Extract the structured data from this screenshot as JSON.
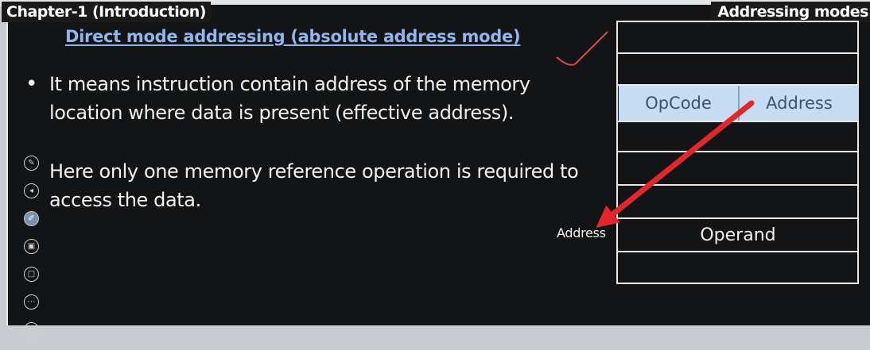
{
  "header": {
    "chapter": "Chapter-1 (Introduction)",
    "topic": "Addressing modes"
  },
  "slide": {
    "title": "Direct mode addressing (absolute address mode)",
    "bullets": [
      {
        "symbol": "•",
        "text": "It means instruction contain address of the memory location where data is present (effective address)."
      },
      {
        "symbol": "•",
        "text": "Here only one memory reference operation is required to access the data."
      }
    ]
  },
  "diagram": {
    "instruction": {
      "opcode": "OpCode",
      "address": "Address"
    },
    "pointer_label": "Address",
    "operand": "Operand"
  },
  "colors": {
    "title": "#8fb7ec",
    "instruction_fill": "#c5dcf2",
    "arrow": "#e3262b"
  }
}
